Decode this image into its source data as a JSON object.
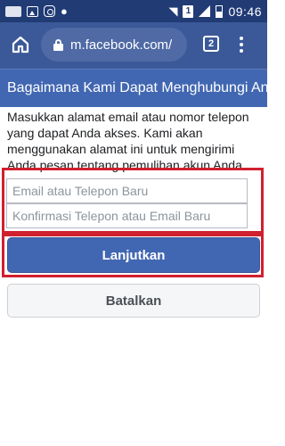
{
  "status_bar": {
    "time": "09:46",
    "sim_label": "1",
    "icons": [
      "app-notification-icon",
      "image-icon",
      "instagram-icon",
      "chat-icon",
      "wifi-icon",
      "sim-icon",
      "signal-icon",
      "battery-icon"
    ]
  },
  "browser": {
    "url": "m.facebook.com/",
    "tab_count": "2",
    "icons": [
      "home-icon",
      "lock-icon",
      "tabs-icon",
      "more-menu-icon"
    ]
  },
  "page": {
    "header_title": "Bagaimana Kami Dapat Menghubungi Anda?",
    "description": "Masukkan alamat email atau nomor telepon yang dapat Anda akses. Kami akan menggunakan alamat ini untuk mengirimi Anda pesan tentang pemulihan akun Anda.",
    "email_placeholder": "Email atau Telepon Baru",
    "confirm_placeholder": "Konfirmasi Telepon atau Email Baru",
    "continue_label": "Lanjutkan",
    "cancel_label": "Batalkan"
  },
  "colors": {
    "status_bar": "#213b75",
    "browser_bar": "#3b5998",
    "header_bar": "#4267b2",
    "primary_button": "#4267b2",
    "highlight": "#d0202e"
  }
}
